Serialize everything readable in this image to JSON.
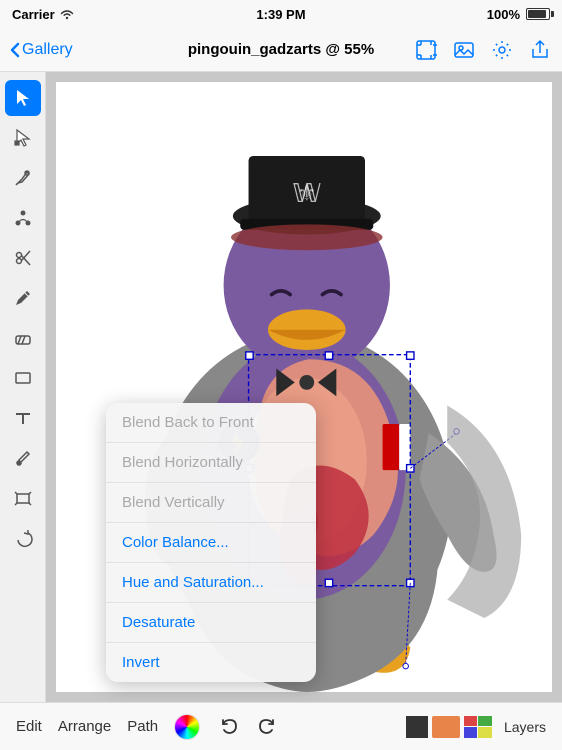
{
  "statusBar": {
    "carrier": "Carrier",
    "wifi": "WiFi",
    "time": "1:39 PM",
    "battery": "100%"
  },
  "topBar": {
    "galleryLabel": "Gallery",
    "title": "pingouin_gadzarts @ 55%"
  },
  "toolbar": {
    "tools": [
      {
        "name": "select",
        "label": "Select",
        "active": true
      },
      {
        "name": "direct-select",
        "label": "Direct Select",
        "active": false
      },
      {
        "name": "pen",
        "label": "Pen",
        "active": false
      },
      {
        "name": "node",
        "label": "Node",
        "active": false
      },
      {
        "name": "scissors",
        "label": "Scissors",
        "active": false
      },
      {
        "name": "pencil",
        "label": "Pencil",
        "active": false
      },
      {
        "name": "eraser",
        "label": "Eraser",
        "active": false
      },
      {
        "name": "rectangle",
        "label": "Rectangle",
        "active": false
      },
      {
        "name": "text",
        "label": "Text",
        "active": false
      },
      {
        "name": "eyedropper",
        "label": "Eyedropper",
        "active": false
      },
      {
        "name": "transform",
        "label": "Transform",
        "active": false
      },
      {
        "name": "rotate",
        "label": "Rotate",
        "active": false
      }
    ]
  },
  "contextMenu": {
    "items": [
      {
        "label": "Blend Back to Front",
        "state": "disabled",
        "color": "default"
      },
      {
        "label": "Blend Horizontally",
        "state": "disabled",
        "color": "default"
      },
      {
        "label": "Blend Vertically",
        "state": "disabled",
        "color": "default"
      },
      {
        "label": "Color Balance...",
        "state": "enabled",
        "color": "blue"
      },
      {
        "label": "Hue and Saturation...",
        "state": "enabled",
        "color": "blue"
      },
      {
        "label": "Desaturate",
        "state": "enabled",
        "color": "blue"
      },
      {
        "label": "Invert",
        "state": "enabled",
        "color": "blue"
      }
    ]
  },
  "bottomBar": {
    "editLabel": "Edit",
    "arrangeLabel": "Arrange",
    "pathLabel": "Path",
    "layersLabel": "Layers",
    "undoTitle": "Undo",
    "redoTitle": "Redo"
  }
}
